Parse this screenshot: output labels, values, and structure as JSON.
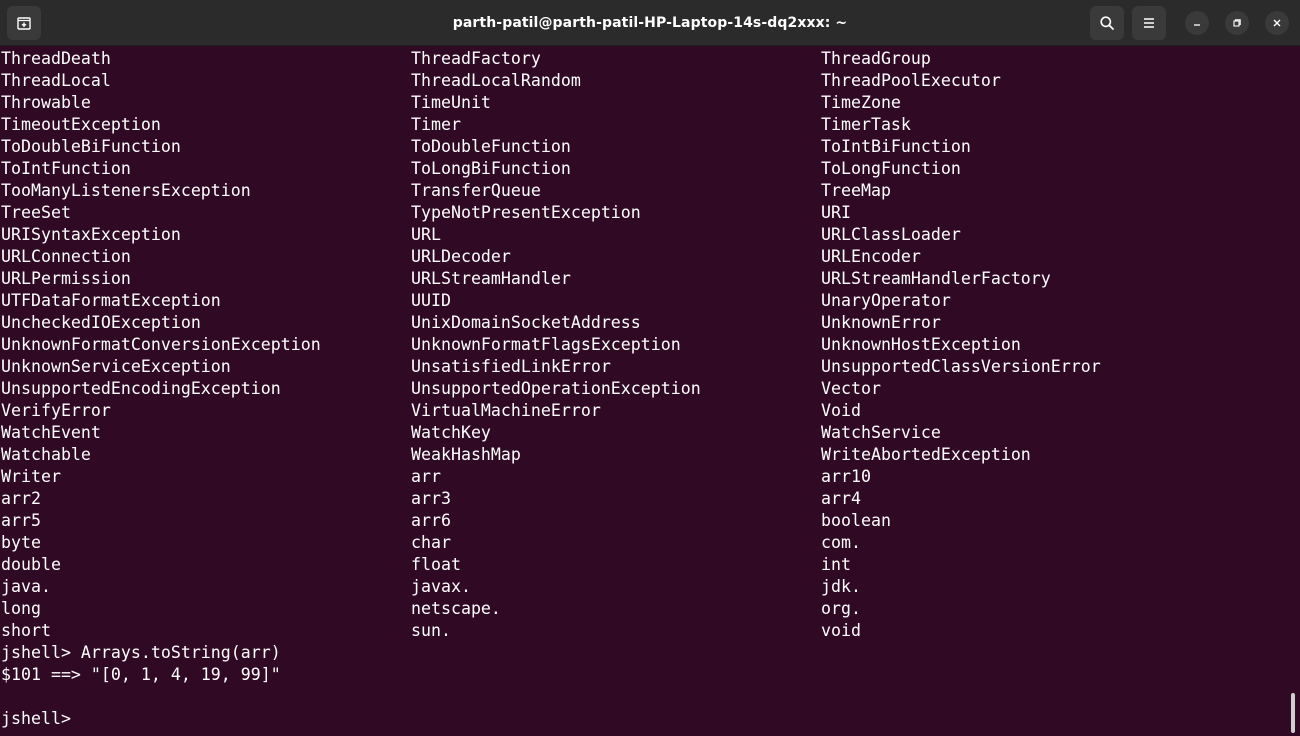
{
  "window": {
    "title": "parth-patil@parth-patil-HP-Laptop-14s-dq2xxx: ~",
    "icons": [
      "new-tab-icon",
      "search-icon",
      "hamburger-menu-icon",
      "minimize-icon",
      "restore-icon",
      "close-icon"
    ]
  },
  "colors": {
    "terminal_bg": "#300a24",
    "titlebar_bg": "#2b2b2b",
    "text": "#ffffff"
  },
  "terminal": {
    "completion_rows": [
      [
        "ThreadDeath",
        "ThreadFactory",
        "ThreadGroup"
      ],
      [
        "ThreadLocal",
        "ThreadLocalRandom",
        "ThreadPoolExecutor"
      ],
      [
        "Throwable",
        "TimeUnit",
        "TimeZone"
      ],
      [
        "TimeoutException",
        "Timer",
        "TimerTask"
      ],
      [
        "ToDoubleBiFunction",
        "ToDoubleFunction",
        "ToIntBiFunction"
      ],
      [
        "ToIntFunction",
        "ToLongBiFunction",
        "ToLongFunction"
      ],
      [
        "TooManyListenersException",
        "TransferQueue",
        "TreeMap"
      ],
      [
        "TreeSet",
        "TypeNotPresentException",
        "URI"
      ],
      [
        "URISyntaxException",
        "URL",
        "URLClassLoader"
      ],
      [
        "URLConnection",
        "URLDecoder",
        "URLEncoder"
      ],
      [
        "URLPermission",
        "URLStreamHandler",
        "URLStreamHandlerFactory"
      ],
      [
        "UTFDataFormatException",
        "UUID",
        "UnaryOperator"
      ],
      [
        "UncheckedIOException",
        "UnixDomainSocketAddress",
        "UnknownError"
      ],
      [
        "UnknownFormatConversionException",
        "UnknownFormatFlagsException",
        "UnknownHostException"
      ],
      [
        "UnknownServiceException",
        "UnsatisfiedLinkError",
        "UnsupportedClassVersionError"
      ],
      [
        "UnsupportedEncodingException",
        "UnsupportedOperationException",
        "Vector"
      ],
      [
        "VerifyError",
        "VirtualMachineError",
        "Void"
      ],
      [
        "WatchEvent",
        "WatchKey",
        "WatchService"
      ],
      [
        "Watchable",
        "WeakHashMap",
        "WriteAbortedException"
      ],
      [
        "Writer",
        "arr",
        "arr10"
      ],
      [
        "arr2",
        "arr3",
        "arr4"
      ],
      [
        "arr5",
        "arr6",
        "boolean"
      ],
      [
        "byte",
        "char",
        "com."
      ],
      [
        "double",
        "float",
        "int"
      ],
      [
        "java.",
        "javax.",
        "jdk."
      ],
      [
        "long",
        "netscape.",
        "org."
      ],
      [
        "short",
        "sun.",
        "void"
      ]
    ],
    "prompt_command": "jshell> Arrays.toString(arr)",
    "result": "$101 ==> \"[0, 1, 4, 19, 99]\"",
    "blank": "",
    "prompt_current": "jshell> "
  }
}
